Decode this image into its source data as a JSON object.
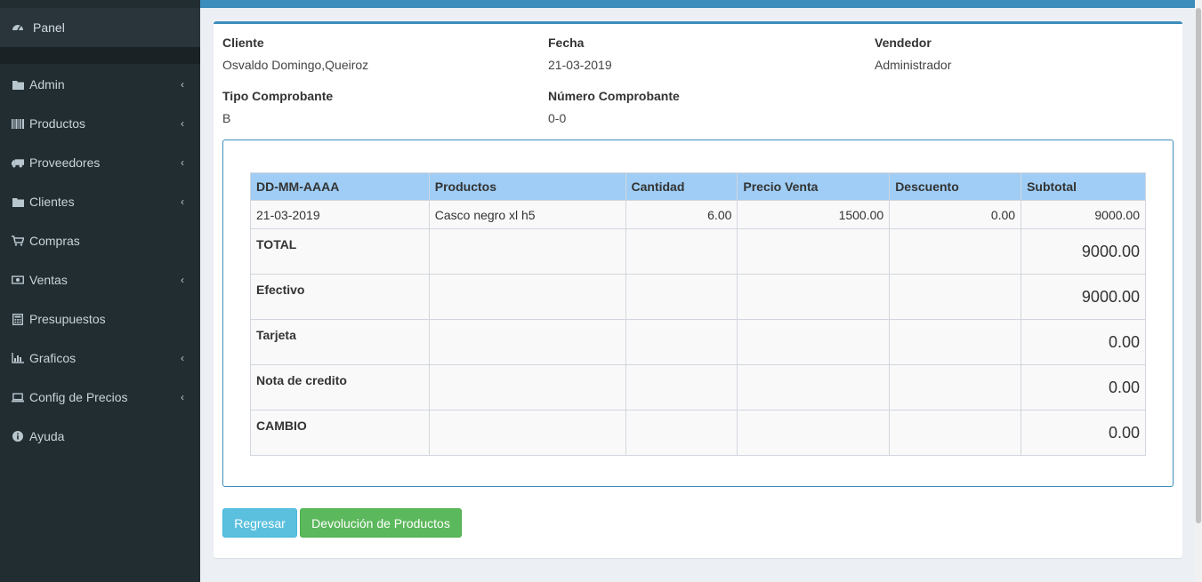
{
  "sidebar": {
    "panel": {
      "label": "Panel",
      "icon": "dashboard-icon"
    },
    "items": [
      {
        "label": "Admin",
        "icon": "folder-icon",
        "has_children": true
      },
      {
        "label": "Productos",
        "icon": "barcode-icon",
        "has_children": true
      },
      {
        "label": "Proveedores",
        "icon": "truck-icon",
        "has_children": true
      },
      {
        "label": "Clientes",
        "icon": "folder-icon",
        "has_children": true
      },
      {
        "label": "Compras",
        "icon": "cart-icon",
        "has_children": false
      },
      {
        "label": "Ventas",
        "icon": "money-icon",
        "has_children": true
      },
      {
        "label": "Presupuestos",
        "icon": "calculator-icon",
        "has_children": false
      },
      {
        "label": "Graficos",
        "icon": "bar-chart-icon",
        "has_children": true
      },
      {
        "label": "Config de Precios",
        "icon": "laptop-icon",
        "has_children": true
      },
      {
        "label": "Ayuda",
        "icon": "info-icon",
        "has_children": false
      }
    ]
  },
  "header": {
    "cliente_label": "Cliente",
    "cliente_value": "Osvaldo Domingo,Queiroz",
    "fecha_label": "Fecha",
    "fecha_value": "21-03-2019",
    "vendedor_label": "Vendedor",
    "vendedor_value": "Administrador",
    "tipo_label": "Tipo Comprobante",
    "tipo_value": "B",
    "numero_label": "Número Comprobante",
    "numero_value": "0-0"
  },
  "table": {
    "columns": [
      "DD-MM-AAAA",
      "Productos",
      "Cantidad",
      "Precio Venta",
      "Descuento",
      "Subtotal"
    ],
    "rows": [
      [
        "21-03-2019",
        "Casco negro xl h5",
        "6.00",
        "1500.00",
        "0.00",
        "9000.00"
      ]
    ],
    "summary": [
      {
        "label": "TOTAL",
        "value": "9000.00"
      },
      {
        "label": "Efectivo",
        "value": "9000.00"
      },
      {
        "label": "Tarjeta",
        "value": "0.00"
      },
      {
        "label": "Nota de credito",
        "value": "0.00"
      },
      {
        "label": "CAMBIO",
        "value": "0.00"
      }
    ]
  },
  "buttons": {
    "back": "Regresar",
    "return_products": "Devolución de Productos"
  },
  "colors": {
    "sidebar_bg": "#222d32",
    "accent": "#3c8dbc",
    "table_header": "#9fcdf5",
    "btn_info": "#5bc0de",
    "btn_success": "#5cb85c"
  }
}
